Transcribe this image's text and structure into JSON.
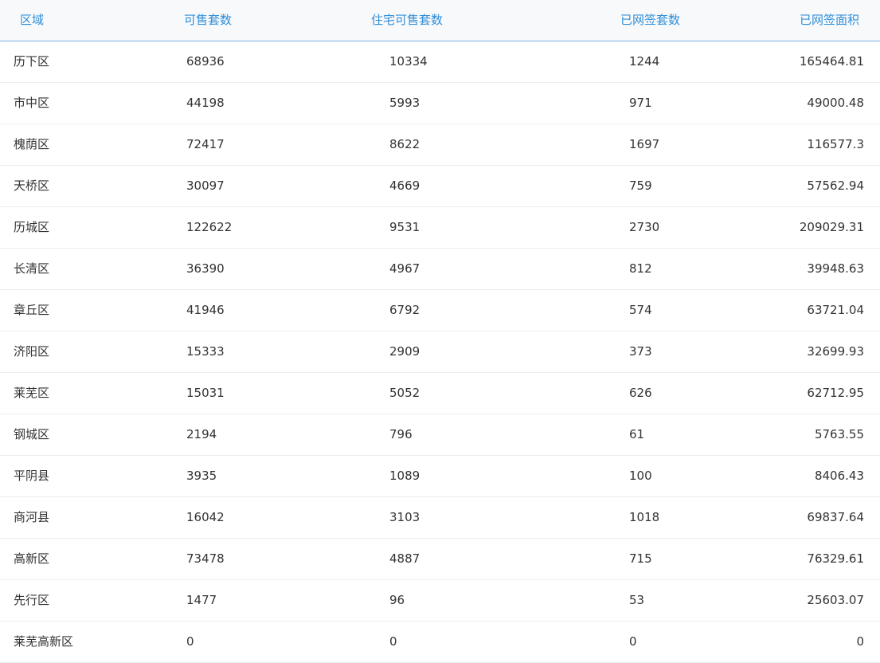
{
  "headers": {
    "region": "区域",
    "available_units": "可售套数",
    "residential_available_units": "住宅可售套数",
    "signed_units": "已网签套数",
    "signed_area": "已网签面积"
  },
  "rows": [
    {
      "region": "历下区",
      "available_units": "68936",
      "residential_available_units": "10334",
      "signed_units": "1244",
      "signed_area": "165464.81"
    },
    {
      "region": "市中区",
      "available_units": "44198",
      "residential_available_units": "5993",
      "signed_units": "971",
      "signed_area": "49000.48"
    },
    {
      "region": "槐荫区",
      "available_units": "72417",
      "residential_available_units": "8622",
      "signed_units": "1697",
      "signed_area": "116577.3"
    },
    {
      "region": "天桥区",
      "available_units": "30097",
      "residential_available_units": "4669",
      "signed_units": "759",
      "signed_area": "57562.94"
    },
    {
      "region": "历城区",
      "available_units": "122622",
      "residential_available_units": "9531",
      "signed_units": "2730",
      "signed_area": "209029.31"
    },
    {
      "region": "长清区",
      "available_units": "36390",
      "residential_available_units": "4967",
      "signed_units": "812",
      "signed_area": "39948.63"
    },
    {
      "region": "章丘区",
      "available_units": "41946",
      "residential_available_units": "6792",
      "signed_units": "574",
      "signed_area": "63721.04"
    },
    {
      "region": "济阳区",
      "available_units": "15333",
      "residential_available_units": "2909",
      "signed_units": "373",
      "signed_area": "32699.93"
    },
    {
      "region": "莱芜区",
      "available_units": "15031",
      "residential_available_units": "5052",
      "signed_units": "626",
      "signed_area": "62712.95"
    },
    {
      "region": "钢城区",
      "available_units": "2194",
      "residential_available_units": "796",
      "signed_units": "61",
      "signed_area": "5763.55"
    },
    {
      "region": "平阴县",
      "available_units": "3935",
      "residential_available_units": "1089",
      "signed_units": "100",
      "signed_area": "8406.43"
    },
    {
      "region": "商河县",
      "available_units": "16042",
      "residential_available_units": "3103",
      "signed_units": "1018",
      "signed_area": "69837.64"
    },
    {
      "region": "高新区",
      "available_units": "73478",
      "residential_available_units": "4887",
      "signed_units": "715",
      "signed_area": "76329.61"
    },
    {
      "region": "先行区",
      "available_units": "1477",
      "residential_available_units": "96",
      "signed_units": "53",
      "signed_area": "25603.07"
    },
    {
      "region": "莱芜高新区",
      "available_units": "0",
      "residential_available_units": "0",
      "signed_units": "0",
      "signed_area": "0"
    }
  ]
}
